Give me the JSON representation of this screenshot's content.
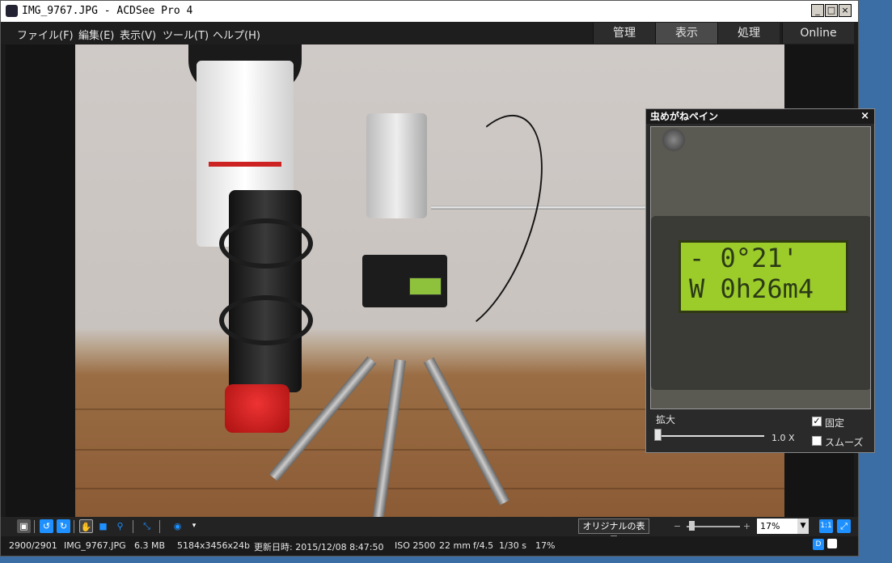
{
  "window": {
    "title": "IMG_9767.JPG - ACDSee Pro 4",
    "controls": {
      "minimize": "_",
      "maximize": "□",
      "close": "×"
    }
  },
  "menu": {
    "items": [
      "ファイル(F)",
      "編集(E)",
      "表示(V)",
      "ツール(T)",
      "ヘルプ(H)"
    ]
  },
  "modes": {
    "tabs": [
      {
        "label": "管理",
        "active": false
      },
      {
        "label": "表示",
        "active": true
      },
      {
        "label": "処理",
        "active": false
      },
      {
        "label": "Online",
        "active": false
      }
    ]
  },
  "magnifier": {
    "title": "虫めがねペイン",
    "close": "×",
    "lcd_line1": "- 0°21'",
    "lcd_line2": "W 0h26m4",
    "zoom_label": "拡大",
    "zoom_value": "1.0",
    "zoom_unit": "X",
    "fixed_label": "固定",
    "fixed_checked": true,
    "smooth_label": "スムーズ",
    "smooth_checked": false
  },
  "toolbar": {
    "original_button": "オリジナルの表示",
    "zoom_minus": "−",
    "zoom_plus": "+",
    "zoom_percent": "17%",
    "accent": "#1e90ff"
  },
  "status": {
    "index": "2900/2901",
    "filename": "IMG_9767.JPG",
    "size": "6.3 MB",
    "dimensions": "5184x3456x24b",
    "modified": "更新日時: 2015/12/08 8:47:50",
    "iso": "ISO 2500",
    "focal": "22 mm",
    "aperture": "f/4.5",
    "shutter": "1/30 s",
    "zoom": "17%"
  }
}
